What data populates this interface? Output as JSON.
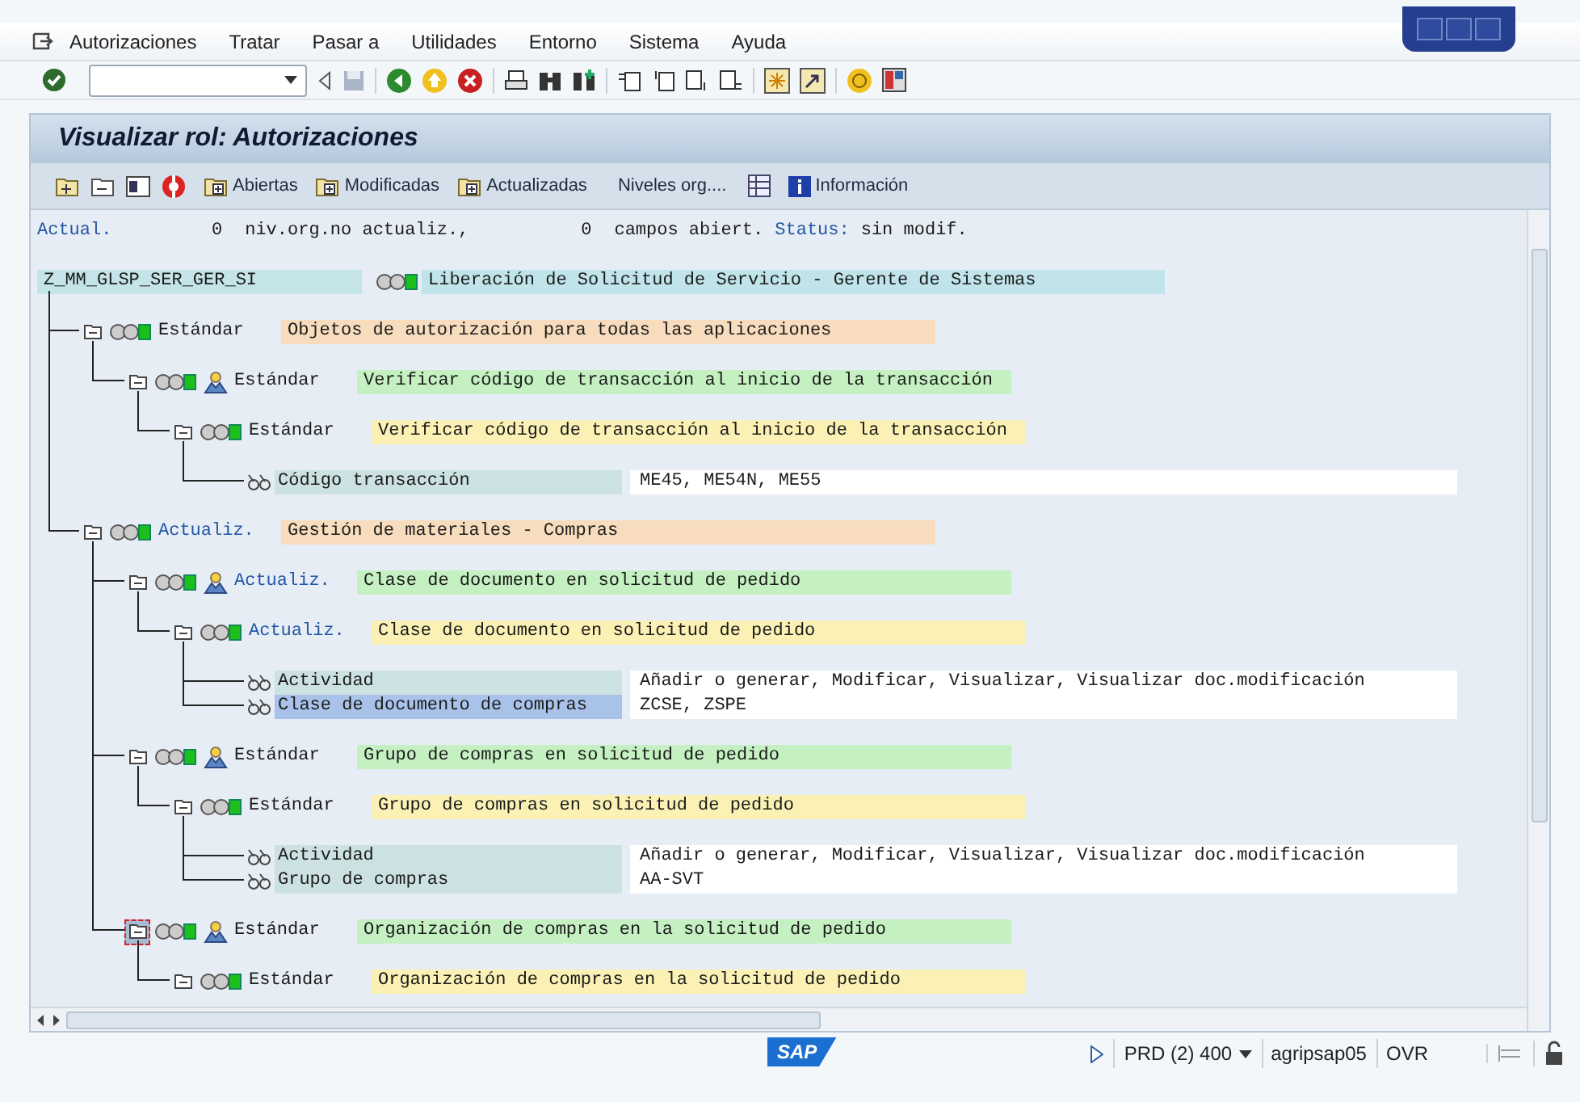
{
  "menu": [
    "Autorizaciones",
    "Tratar",
    "Pasar a",
    "Utilidades",
    "Entorno",
    "Sistema",
    "Ayuda"
  ],
  "title": "Visualizar rol: Autorizaciones",
  "app_toolbar": [
    "Abiertas",
    "Modificadas",
    "Actualizadas",
    "Niveles org....",
    "Información"
  ],
  "summary": {
    "label": "Actual.",
    "count_1": "0",
    "text_1": "niv.org.no actualiz.,",
    "count_2": "0",
    "text_2": "campos abiert.",
    "status_label": "Status:",
    "status": "sin modif."
  },
  "tree": {
    "name": "Z_MM_GLSP_SER_GER_SI",
    "description": "Liberación de Solicitud de Servicio - Gerente de Sistemas",
    "children": [
      {
        "kind": "class",
        "status": "Estándar",
        "updated": false,
        "selected": false,
        "description": "Objetos de autorización para todas las aplicaciones",
        "children": [
          {
            "kind": "object",
            "status": "Estándar",
            "updated": false,
            "selected": false,
            "description": "Verificar código de transacción al inicio de la transacción",
            "children": [
              {
                "kind": "authorization",
                "status": "Estándar",
                "updated": false,
                "selected": false,
                "description": "Verificar código de transacción al inicio de la transacción",
                "fields": [
                  {
                    "name": "Código transacción",
                    "value": "ME45, ME54N, ME55",
                    "selected": false
                  }
                ]
              }
            ]
          }
        ]
      },
      {
        "kind": "class",
        "status": "Actualiz.",
        "updated": true,
        "selected": false,
        "description": "Gestión de materiales - Compras",
        "children": [
          {
            "kind": "object",
            "status": "Actualiz.",
            "updated": true,
            "selected": false,
            "description": "Clase de documento en solicitud de pedido",
            "children": [
              {
                "kind": "authorization",
                "status": "Actualiz.",
                "updated": true,
                "selected": false,
                "description": "Clase de documento en solicitud de pedido",
                "fields": [
                  {
                    "name": "Actividad",
                    "value": "Añadir o generar, Modificar, Visualizar, Visualizar doc.modificación",
                    "selected": false
                  },
                  {
                    "name": "Clase de documento de compras",
                    "value": "ZCSE, ZSPE",
                    "selected": true
                  }
                ]
              }
            ]
          },
          {
            "kind": "object",
            "status": "Estándar",
            "updated": false,
            "selected": false,
            "description": "Grupo de compras en solicitud de pedido",
            "children": [
              {
                "kind": "authorization",
                "status": "Estándar",
                "updated": false,
                "selected": false,
                "description": "Grupo de compras en solicitud de pedido",
                "fields": [
                  {
                    "name": "Actividad",
                    "value": "Añadir o generar, Modificar, Visualizar, Visualizar doc.modificación",
                    "selected": false
                  },
                  {
                    "name": "Grupo de compras",
                    "value": "AA-SVT",
                    "selected": false
                  }
                ]
              }
            ]
          },
          {
            "kind": "object",
            "status": "Estándar",
            "updated": false,
            "selected": true,
            "description": "Organización de compras en la solicitud de pedido",
            "children": [
              {
                "kind": "authorization",
                "status": "Estándar",
                "updated": false,
                "selected": false,
                "description": "Organización de compras en la solicitud de pedido"
              }
            ]
          }
        ]
      }
    ]
  },
  "status_bar": {
    "logo": "SAP",
    "system": "PRD (2) 400",
    "server": "agripsap05",
    "mode": "OVR"
  }
}
